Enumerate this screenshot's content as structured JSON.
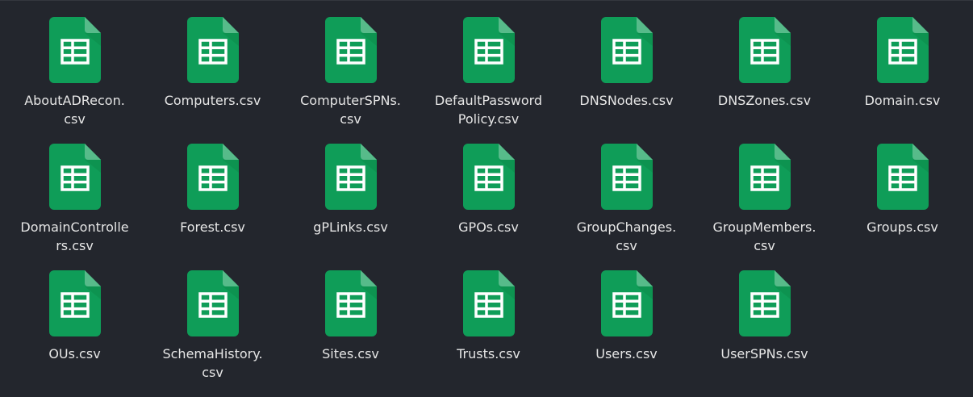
{
  "files": [
    {
      "name": "AboutADRecon.\ncsv",
      "icon": "spreadsheet-icon"
    },
    {
      "name": "Computers.csv",
      "icon": "spreadsheet-icon"
    },
    {
      "name": "ComputerSPNs.\ncsv",
      "icon": "spreadsheet-icon"
    },
    {
      "name": "DefaultPassword\nPolicy.csv",
      "icon": "spreadsheet-icon"
    },
    {
      "name": "DNSNodes.csv",
      "icon": "spreadsheet-icon"
    },
    {
      "name": "DNSZones.csv",
      "icon": "spreadsheet-icon"
    },
    {
      "name": "Domain.csv",
      "icon": "spreadsheet-icon"
    },
    {
      "name": "DomainControlle\nrs.csv",
      "icon": "spreadsheet-icon"
    },
    {
      "name": "Forest.csv",
      "icon": "spreadsheet-icon"
    },
    {
      "name": "gPLinks.csv",
      "icon": "spreadsheet-icon"
    },
    {
      "name": "GPOs.csv",
      "icon": "spreadsheet-icon"
    },
    {
      "name": "GroupChanges.\ncsv",
      "icon": "spreadsheet-icon"
    },
    {
      "name": "GroupMembers.\ncsv",
      "icon": "spreadsheet-icon"
    },
    {
      "name": "Groups.csv",
      "icon": "spreadsheet-icon"
    },
    {
      "name": "OUs.csv",
      "icon": "spreadsheet-icon"
    },
    {
      "name": "SchemaHistory.\ncsv",
      "icon": "spreadsheet-icon"
    },
    {
      "name": "Sites.csv",
      "icon": "spreadsheet-icon"
    },
    {
      "name": "Trusts.csv",
      "icon": "spreadsheet-icon"
    },
    {
      "name": "Users.csv",
      "icon": "spreadsheet-icon"
    },
    {
      "name": "UserSPNs.csv",
      "icon": "spreadsheet-icon"
    }
  ],
  "colors": {
    "background": "#23262d",
    "icon_green": "#0f9d58",
    "icon_fold": "#57bb8a",
    "text": "#e6e6e6"
  }
}
